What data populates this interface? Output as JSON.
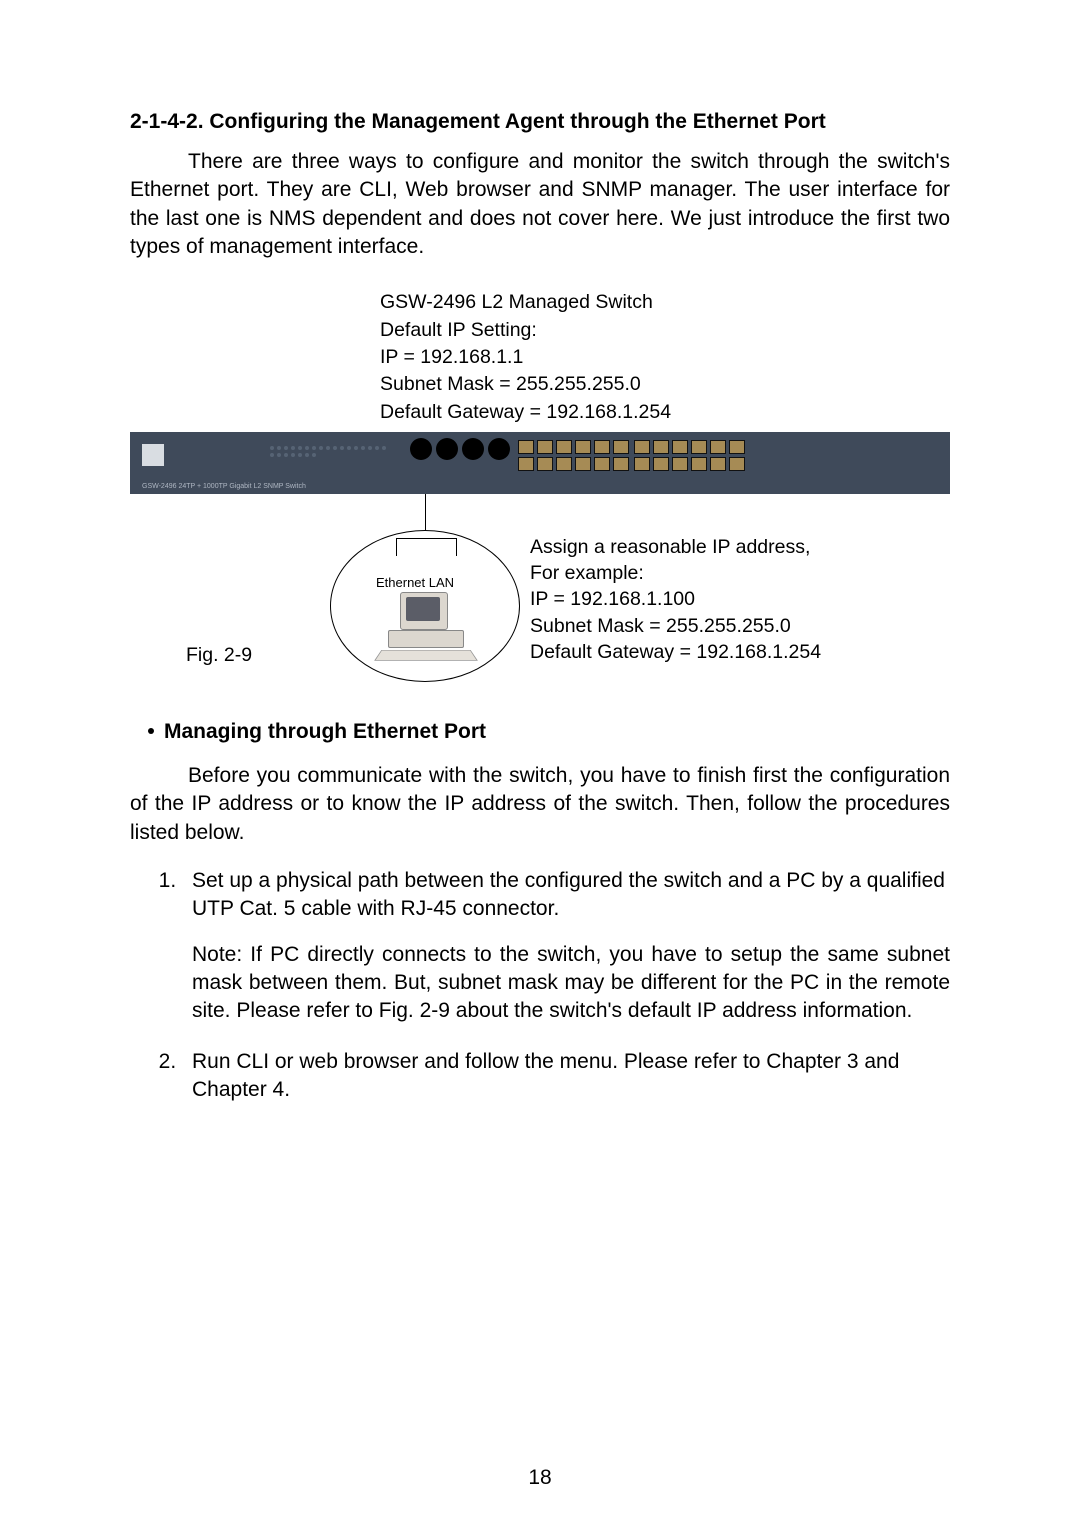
{
  "section": {
    "number": "2-1-4-2.",
    "title": "Configuring the Management Agent through the Ethernet Port"
  },
  "intro": "There are three ways to configure and monitor the switch through the switch's Ethernet port. They are CLI, Web browser and SNMP manager. The user interface for the last one is NMS dependent and does not cover here. We just introduce the first two types of management interface.",
  "switch_config": {
    "title": "GSW-2496 L2 Managed Switch",
    "setting_label": "Default IP Setting:",
    "ip": "IP = 192.168.1.1",
    "mask": "Subnet Mask = 255.255.255.0",
    "gateway": "Default Gateway = 192.168.1.254"
  },
  "switch_model_label": "GSW-2496 24TP + 1000TP Gigabit L2 SNMP Switch",
  "diagram": {
    "lan_label": "Ethernet LAN",
    "caption": "Fig. 2-9"
  },
  "pc_config": {
    "line1": "Assign a reasonable IP address,",
    "line2": "For example:",
    "ip": "IP = 192.168.1.100",
    "mask": "Subnet Mask = 255.255.255.0",
    "gateway": "Default Gateway = 192.168.1.254"
  },
  "sub_heading": "Managing through Ethernet Port",
  "sub_intro": "Before you communicate with the switch, you have to finish first the configuration of the IP address or to know the IP address of the switch. Then, follow the procedures listed below.",
  "steps": {
    "s1": "Set up a physical path between the configured the switch and a PC by a qualified UTP Cat. 5 cable with RJ-45 connector.",
    "note": "Note: If PC directly connects to the switch, you have to setup the same subnet mask between them. But, subnet mask may be different for the PC in the remote site. Please refer to Fig. 2-9 about the switch's default IP address information.",
    "s2": "Run CLI or web browser and follow the menu. Please refer to Chapter 3 and Chapter 4."
  },
  "page_number": "18"
}
